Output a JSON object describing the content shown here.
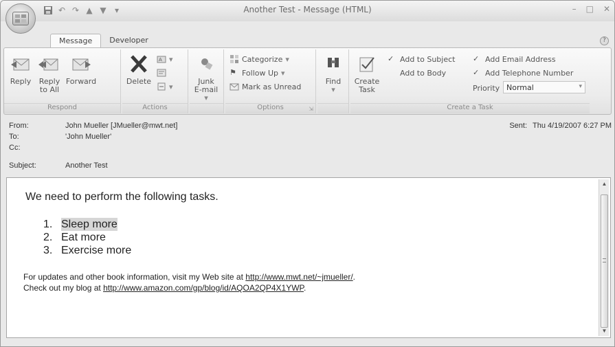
{
  "window": {
    "title": "Another Test - Message (HTML)"
  },
  "tabs": [
    {
      "label": "Message",
      "active": true
    },
    {
      "label": "Developer",
      "active": false
    }
  ],
  "ribbon": {
    "respond": {
      "label": "Respond",
      "reply": "Reply",
      "reply_all_line1": "Reply",
      "reply_all_line2": "to All",
      "forward": "Forward"
    },
    "actions": {
      "label": "Actions",
      "delete": "Delete"
    },
    "junk": {
      "line1": "Junk",
      "line2": "E-mail"
    },
    "options": {
      "label": "Options",
      "categorize": "Categorize",
      "follow_up": "Follow Up",
      "mark_unread": "Mark as Unread"
    },
    "find": {
      "label": "Find"
    },
    "create_task": {
      "group_label": "Create a Task",
      "button_line1": "Create",
      "button_line2": "Task",
      "add_to_subject": "Add to Subject",
      "add_to_body": "Add to Body",
      "add_email_address": "Add Email Address",
      "add_telephone_number": "Add Telephone Number",
      "priority_label": "Priority",
      "priority_value": "Normal"
    }
  },
  "header": {
    "from_label": "From:",
    "from_value": "John Mueller [JMueller@mwt.net]",
    "to_label": "To:",
    "to_value": "'John Mueller'",
    "cc_label": "Cc:",
    "cc_value": "",
    "subject_label": "Subject:",
    "subject_value": "Another Test",
    "sent_label": "Sent:",
    "sent_value": "Thu 4/19/2007 6:27 PM"
  },
  "body": {
    "intro": "We need to perform the following tasks.",
    "tasks": [
      {
        "num": "1.",
        "text": "Sleep more"
      },
      {
        "num": "2.",
        "text": "Eat more"
      },
      {
        "num": "3.",
        "text": "Exercise more"
      }
    ],
    "line1_prefix": "For updates and other book information, visit my Web site at ",
    "line1_link": "http://www.mwt.net/~jmueller/",
    "line1_suffix": ".",
    "line2_prefix": "Check out my blog at ",
    "line2_link": "http://www.amazon.com/gp/blog/id/AQOA2QP4X1YWP",
    "line2_suffix": "."
  },
  "colors": {
    "chrome": "#e9e9e9",
    "ribbon": "#f5f5f5",
    "text": "#222222"
  }
}
